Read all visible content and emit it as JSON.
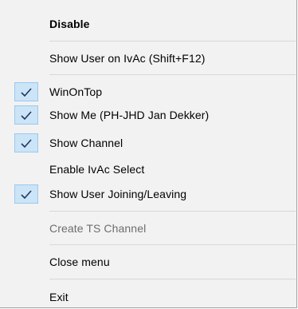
{
  "menu": {
    "items": [
      {
        "label": "Disable",
        "checked": false,
        "bold": true,
        "disabled": false
      },
      {
        "label": "Show User on IvAc (Shift+F12)",
        "checked": false,
        "bold": false,
        "disabled": false
      },
      {
        "label": "WinOnTop",
        "checked": true,
        "bold": false,
        "disabled": false
      },
      {
        "label": "Show Me  (PH-JHD Jan Dekker)",
        "checked": true,
        "bold": false,
        "disabled": false
      },
      {
        "label": "Show Channel",
        "checked": true,
        "bold": false,
        "disabled": false
      },
      {
        "label": "Enable IvAc Select",
        "checked": false,
        "bold": false,
        "disabled": false
      },
      {
        "label": "Show User Joining/Leaving",
        "checked": true,
        "bold": false,
        "disabled": false
      },
      {
        "label": "Create TS Channel",
        "checked": false,
        "bold": false,
        "disabled": true
      },
      {
        "label": "Close menu",
        "checked": false,
        "bold": false,
        "disabled": false
      },
      {
        "label": "Exit",
        "checked": false,
        "bold": false,
        "disabled": false
      }
    ],
    "colors": {
      "background": "#f2f2f2",
      "check_highlight": "#cce4f7",
      "check_mark": "#1f3a5f",
      "disabled_text": "#6d6d6d"
    }
  }
}
